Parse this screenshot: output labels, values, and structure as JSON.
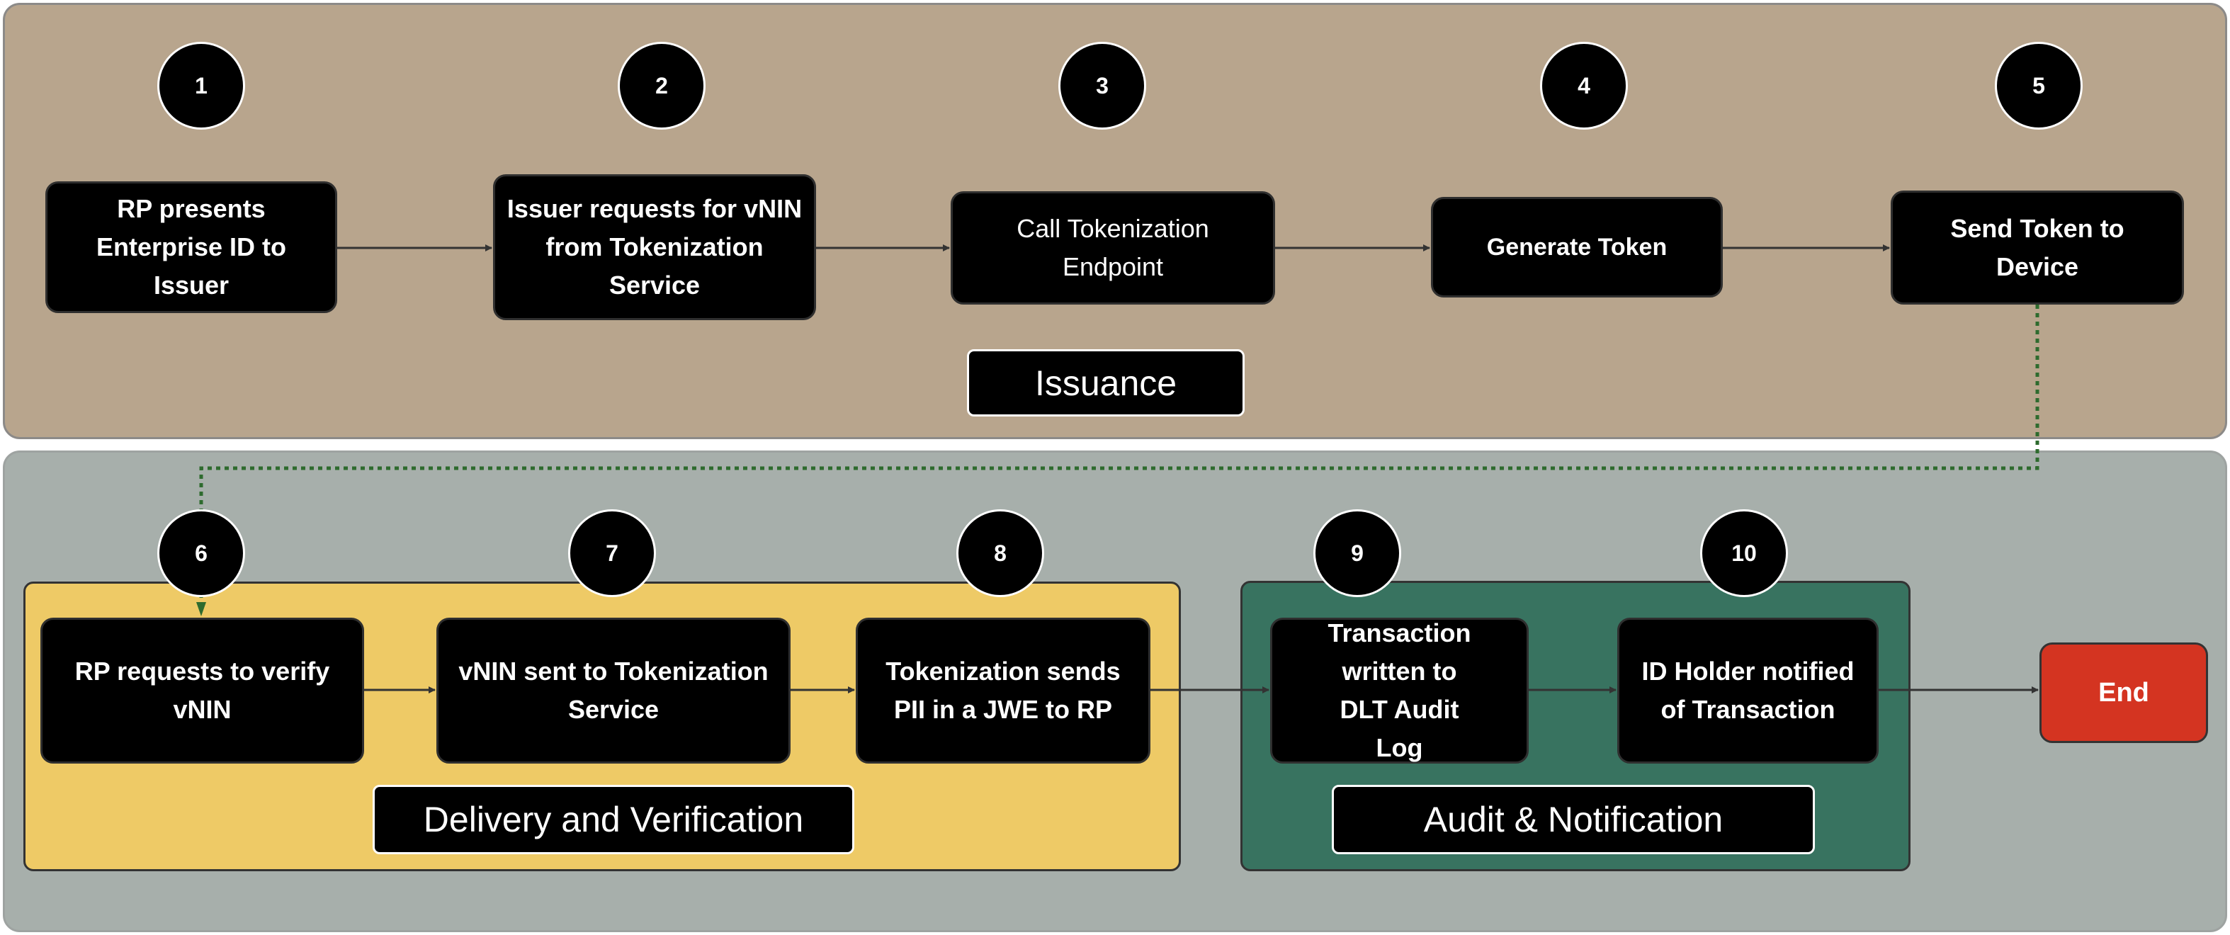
{
  "diagram": {
    "phases": {
      "issuance": "Issuance",
      "delivery": "Delivery and Verification",
      "audit": "Audit & Notification"
    },
    "steps": [
      {
        "number": "1",
        "text": "RP presents Enterprise ID to Issuer"
      },
      {
        "number": "2",
        "text": "Issuer requests for vNIN from Tokenization Service"
      },
      {
        "number": "3",
        "text": "Call Tokenization Endpoint"
      },
      {
        "number": "4",
        "text": "Generate Token"
      },
      {
        "number": "5",
        "text": "Send Token to Device"
      },
      {
        "number": "6",
        "text": "RP requests to verify vNIN"
      },
      {
        "number": "7",
        "text": "vNIN sent to Tokenization Service"
      },
      {
        "number": "8",
        "text": "Tokenization sends PII in a JWE to RP"
      },
      {
        "number": "9",
        "text": "Transaction written to DLT Audit Log"
      },
      {
        "number": "10",
        "text": "ID Holder notified of Transaction"
      }
    ],
    "end": "End",
    "colors": {
      "issuance_panel": "#B8A58D",
      "lower_panel": "#A7AFAB",
      "delivery_group": "#EECA66",
      "audit_group": "#387360",
      "end_node": "#D43421",
      "handoff_link": "#2E6B2E"
    }
  }
}
